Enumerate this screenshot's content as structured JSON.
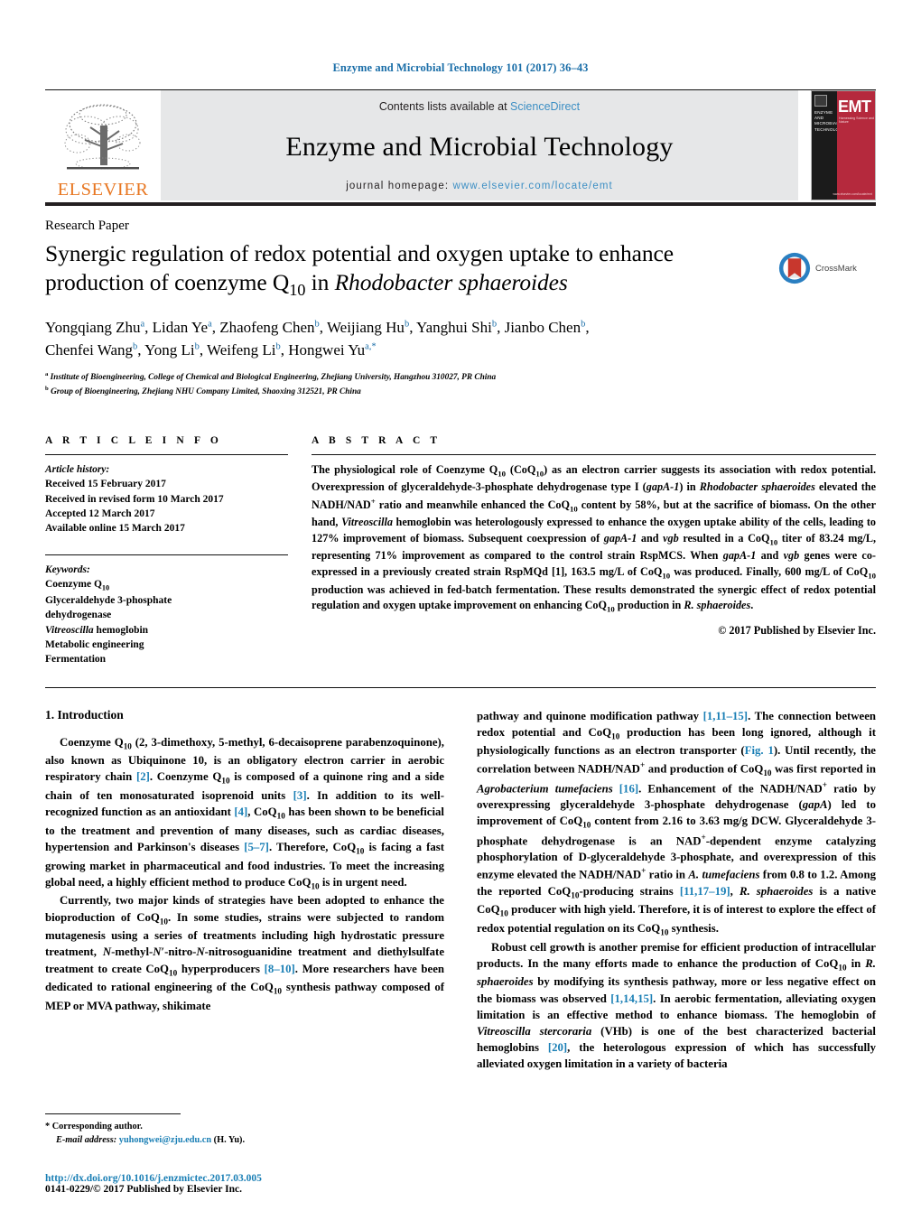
{
  "running_head": "Enzyme and Microbial Technology 101 (2017) 36–43",
  "masthead": {
    "contents_prefix": "Contents lists available at ",
    "sciencedirect": "ScienceDirect",
    "journal_title": "Enzyme and Microbial Technology",
    "homepage_prefix": "journal homepage: ",
    "homepage_url": "www.elsevier.com/locate/emt",
    "publisher_wordmark": "ELSEVIER",
    "cover": {
      "left_title": "ENZYME AND MICROBIAL TECHNOLOGY",
      "big": "EMT",
      "sub": "Harnessing Science and Nature",
      "foot": "www.elsevier.com/locate/emt"
    }
  },
  "article": {
    "type": "Research Paper",
    "title_line1": "Synergic regulation of redox potential and oxygen uptake to enhance",
    "title_line2_pre": "production of coenzyme Q",
    "title_sub": "10",
    "title_line2_mid": " in ",
    "title_italic": "Rhodobacter sphaeroides",
    "crossmark_label": "CrossMark",
    "authors": "Yongqiang Zhu a , Lidan Ye a , Zhaofeng Chen b , Weijiang Hu b , Yanghui Shi b , Jianbo Chen b , Chenfei Wang b , Yong Li b , Weifeng Li b , Hongwei Yu a,*",
    "author_list": [
      {
        "name": "Yongqiang Zhu",
        "mark": "a"
      },
      {
        "name": "Lidan Ye",
        "mark": "a"
      },
      {
        "name": "Zhaofeng Chen",
        "mark": "b"
      },
      {
        "name": "Weijiang Hu",
        "mark": "b"
      },
      {
        "name": "Yanghui Shi",
        "mark": "b"
      },
      {
        "name": "Jianbo Chen",
        "mark": "b"
      },
      {
        "name": "Chenfei Wang",
        "mark": "b"
      },
      {
        "name": "Yong Li",
        "mark": "b"
      },
      {
        "name": "Weifeng Li",
        "mark": "b"
      },
      {
        "name": "Hongwei Yu",
        "mark": "a,*"
      }
    ],
    "affiliations": [
      {
        "mark": "a",
        "text": "Institute of Bioengineering, College of Chemical and Biological Engineering, Zhejiang University, Hangzhou 310027, PR China"
      },
      {
        "mark": "b",
        "text": "Group of Bioengineering, Zhejiang NHU Company Limited, Shaoxing 312521, PR China"
      }
    ]
  },
  "info": {
    "heading": "A R T I C L E   I N F O",
    "history_title": "Article history:",
    "history": [
      "Received 15 February 2017",
      "Received in revised form 10 March 2017",
      "Accepted 12 March 2017",
      "Available online 15 March 2017"
    ],
    "keywords_title": "Keywords:",
    "keywords": [
      "Coenzyme Q10",
      "Glyceraldehyde 3-phosphate",
      "dehydrogenase",
      "Vitreoscilla hemoglobin",
      "Metabolic engineering",
      "Fermentation"
    ]
  },
  "abstract": {
    "heading": "A B S T R A C T",
    "text": "The physiological role of Coenzyme Q10 (CoQ10) as an electron carrier suggests its association with redox potential. Overexpression of glyceraldehyde-3-phosphate dehydrogenase type I (gapA-1) in Rhodobacter sphaeroides elevated the NADH/NAD+ ratio and meanwhile enhanced the CoQ10 content by 58%, but at the sacrifice of biomass. On the other hand, Vitreoscilla hemoglobin was heterologously expressed to enhance the oxygen uptake ability of the cells, leading to 127% improvement of biomass. Subsequent coexpression of gapA-1 and vgb resulted in a CoQ10 titer of 83.24 mg/L, representing 71% improvement as compared to the control strain RspMCS. When gapA-1 and vgb genes were co-expressed in a previously created strain RspMQd [1], 163.5 mg/L of CoQ10 was produced. Finally, 600 mg/L of CoQ10 production was achieved in fed-batch fermentation. These results demonstrated the synergic effect of redox potential regulation and oxygen uptake improvement on enhancing CoQ10 production in R. sphaeroides.",
    "copyright": "© 2017 Published by Elsevier Inc."
  },
  "body": {
    "section_heading": "1.  Introduction",
    "left_paragraphs": [
      "Coenzyme Q10 (2, 3-dimethoxy, 5-methyl, 6-decaisoprene parabenzoquinone), also known as Ubiquinone 10, is an obligatory electron carrier in aerobic respiratory chain [2]. Coenzyme Q10 is composed of a quinone ring and a side chain of ten monosaturated isoprenoid units [3]. In addition to its well-recognized function as an antioxidant [4], CoQ10 has been shown to be beneficial to the treatment and prevention of many diseases, such as cardiac diseases, hypertension and Parkinson's diseases [5–7]. Therefore, CoQ10 is facing a fast growing market in pharmaceutical and food industries. To meet the increasing global need, a highly efficient method to produce CoQ10 is in urgent need.",
      "Currently, two major kinds of strategies have been adopted to enhance the bioproduction of CoQ10. In some studies, strains were subjected to random mutagenesis using a series of treatments including high hydrostatic pressure treatment, N-methyl-N'-nitro-N-nitrosoguanidine treatment and diethylsulfate treatment to create CoQ10 hyperproducers [8–10]. More researchers have been dedicated to rational engineering of the CoQ10 synthesis pathway composed of MEP or MVA pathway, shikimate"
    ],
    "right_paragraphs": [
      "pathway and quinone modification pathway [1,11–15]. The connection between redox potential and CoQ10 production has been long ignored, although it physiologically functions as an electron transporter (Fig. 1). Until recently, the correlation between NADH/NAD+ and production of CoQ10 was first reported in Agrobacterium tumefaciens [16]. Enhancement of the NADH/NAD+ ratio by overexpressing glyceraldehyde 3-phosphate dehydrogenase (gapA) led to improvement of CoQ10 content from 2.16 to 3.63 mg/g DCW. Glyceraldehyde 3-phosphate dehydrogenase is an NAD+-dependent enzyme catalyzing phosphorylation of D-glyceraldehyde 3-phosphate, and overexpression of this enzyme elevated the NADH/NAD+ ratio in A. tumefaciens from 0.8 to 1.2. Among the reported CoQ10-producing strains [11,17–19], R. sphaeroides is a native CoQ10 producer with high yield. Therefore, it is of interest to explore the effect of redox potential regulation on its CoQ10 synthesis.",
      "Robust cell growth is another premise for efficient production of intracellular products. In the many efforts made to enhance the production of CoQ10 in R. sphaeroides by modifying its synthesis pathway, more or less negative effect on the biomass was observed [1,14,15]. In aerobic fermentation, alleviating oxygen limitation is an effective method to enhance biomass. The hemoglobin of Vitreoscilla stercoraria (VHb) is one of the best characterized bacterial hemoglobins [20], the heterologous expression of which has successfully alleviated oxygen limitation in a variety of bacteria"
    ]
  },
  "footnote": {
    "corresponding": "* Corresponding author.",
    "email_label": "E-mail address: ",
    "email": "yuhongwei@zju.edu.cn",
    "email_suffix": " (H. Yu).",
    "doi": "http://dx.doi.org/10.1016/j.enzmictec.2017.03.005",
    "issn": "0141-0229/© 2017 Published by Elsevier Inc."
  },
  "colors": {
    "link": "#1a7fb5",
    "header_blue": "#1a6ea8",
    "elsevier_orange": "#E87722",
    "band_grey": "#e6e7e8",
    "cover_red": "#b5293d"
  }
}
